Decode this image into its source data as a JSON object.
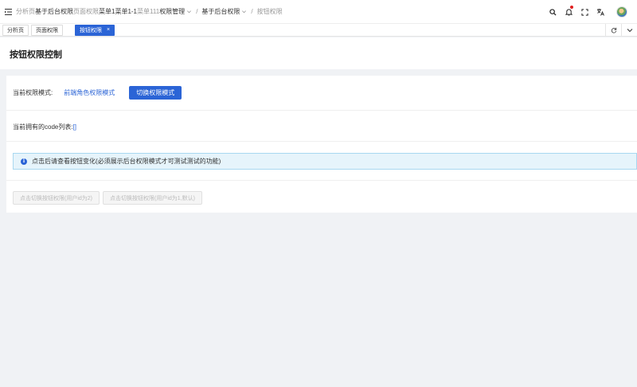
{
  "header": {
    "breadcrumb": [
      {
        "text": "分析页",
        "tone": "muted"
      },
      {
        "text": "基于后台权限",
        "tone": "dark"
      },
      {
        "text": "页面权限",
        "tone": "muted"
      },
      {
        "text": "菜单1菜单1-1",
        "tone": "dark"
      },
      {
        "text": "菜单111",
        "tone": "muted"
      },
      {
        "text": "权限管理",
        "tone": "dark"
      },
      {
        "text": "基于后台权限",
        "tone": "dark"
      },
      {
        "text": "按钮权限",
        "tone": "muted"
      }
    ],
    "separator": "/",
    "icons": [
      "search-icon",
      "bell-icon",
      "fullscreen-icon",
      "translate-icon",
      "avatar"
    ],
    "notification_dot_color": "#e02020"
  },
  "tabs": [
    {
      "label": "分析页",
      "active": false
    },
    {
      "label": "页面权限",
      "active": false
    },
    {
      "label": "按钮权限",
      "active": true,
      "close": "×"
    }
  ],
  "page": {
    "title": "按钮权限控制"
  },
  "permission": {
    "mode_label": "当前权限模式:",
    "mode_value": "前端角色权限模式",
    "switch_button": "切换权限模式",
    "codes_label": "当前拥有的code列表:",
    "codes_value": "[]",
    "alert_icon": "info-icon",
    "alert_text": "点击后请查看按钮变化(必须展示后台权限模式才可测试测试的功能)",
    "buttons": [
      {
        "label": "点击切换按钮权限(用户id为2)",
        "disabled": true
      },
      {
        "label": "点击切换按钮权限(用户id为1,默认)",
        "disabled": true
      }
    ]
  },
  "colors": {
    "primary": "#2b64d6",
    "alert_bg": "#e6f4fb",
    "page_bg": "#f0f2f5"
  }
}
